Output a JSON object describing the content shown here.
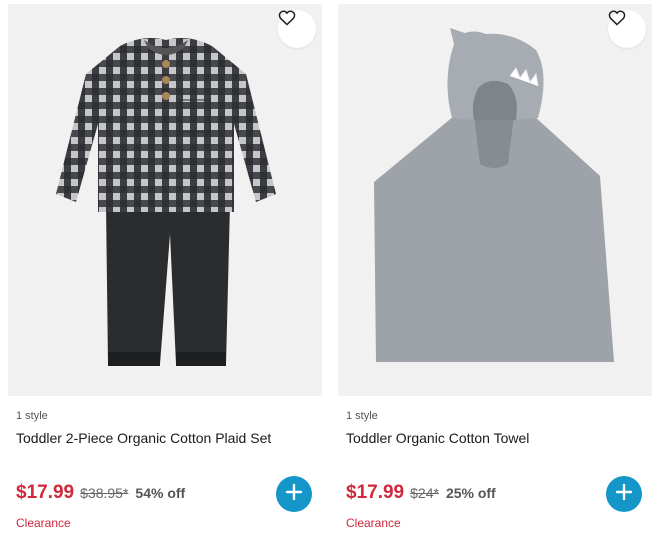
{
  "products": [
    {
      "style_count": "1 style",
      "title": "Toddler 2-Piece Organic Cotton Plaid Set",
      "sale_price": "$17.99",
      "original_price": "$38.95*",
      "discount": "54% off",
      "badge": "Clearance",
      "image_subject": "gray plaid henley top with black pants",
      "favorite_icon": "heart-outline-icon",
      "add_icon": "plus-icon"
    },
    {
      "style_count": "1 style",
      "title": "Toddler Organic Cotton Towel",
      "sale_price": "$17.99",
      "original_price": "$24*",
      "discount": "25% off",
      "badge": "Clearance",
      "image_subject": "gray hooded shark poncho towel",
      "favorite_icon": "heart-outline-icon",
      "add_icon": "plus-icon"
    }
  ],
  "colors": {
    "sale_price": "#d0283d",
    "add_button": "#1496c8",
    "image_background": "#f1f1f1"
  }
}
